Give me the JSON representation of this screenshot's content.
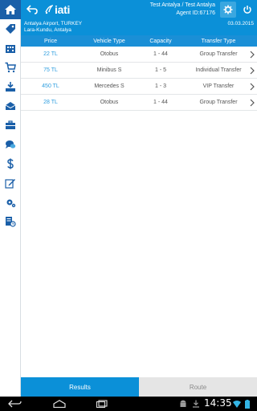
{
  "header": {
    "logo_text": "iati",
    "agent_location": "Test Antalya / Test Antalya",
    "agent_id": "Agent ID:67176"
  },
  "location": {
    "origin": "Antalya Airport, TURKEY",
    "destination": "Lara-Kundu, Antalya",
    "date": "03.03.2015"
  },
  "table": {
    "headers": {
      "price": "Price",
      "vehicle": "Vehicle Type",
      "capacity": "Capacity",
      "transfer": "Transfer Type"
    },
    "rows": [
      {
        "price": "22 TL",
        "vehicle": "Otobus",
        "capacity": "1 - 44",
        "transfer": "Group Transfer"
      },
      {
        "price": "75 TL",
        "vehicle": "Minibus S",
        "capacity": "1 - 5",
        "transfer": "Individual Transfer"
      },
      {
        "price": "450 TL",
        "vehicle": "Mercedes S",
        "capacity": "1 - 3",
        "transfer": "VIP Transfer"
      },
      {
        "price": "28 TL",
        "vehicle": "Otobus",
        "capacity": "1 - 44",
        "transfer": "Group Transfer"
      }
    ]
  },
  "tabs": {
    "results": "Results",
    "route": "Route"
  },
  "system": {
    "clock": "14:35"
  },
  "colors": {
    "accent": "#0b90d8",
    "dark": "#1a5fa8",
    "price": "#2c9ddf"
  }
}
